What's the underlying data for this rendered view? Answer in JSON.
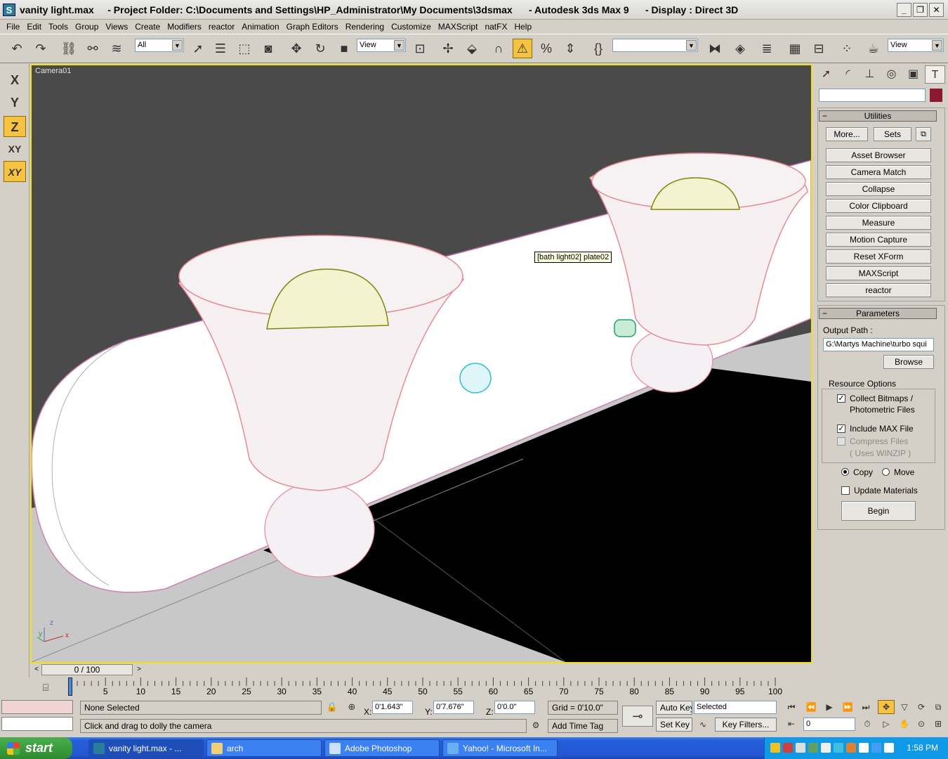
{
  "window": {
    "app_icon": "3ds-max-icon",
    "title": "vanity light.max     - Project Folder: C:\\Documents and Settings\\HP_Administrator\\My Documents\\3dsmax      - Autodesk 3ds Max 9      - Display : Direct 3D",
    "min_label": "_",
    "max_label": "❐",
    "close_label": "✕"
  },
  "menu": [
    "File",
    "Edit",
    "Tools",
    "Group",
    "Views",
    "Create",
    "Modifiers",
    "reactor",
    "Animation",
    "Graph Editors",
    "Rendering",
    "Customize",
    "MAXScript",
    "natFX",
    "Help"
  ],
  "toolbar": {
    "selection_filter": "All",
    "ref_coord": "View",
    "named_selection": "",
    "render_view": "View"
  },
  "axes": [
    "X",
    "Y",
    "Z",
    "XY",
    "XY"
  ],
  "viewport": {
    "label": "Camera01",
    "tooltip": "[bath light02] plate02",
    "axis_tripod": {
      "x": "x",
      "y": "y",
      "z": "z"
    }
  },
  "command_panel": {
    "utilities": {
      "header": "Utilities",
      "more": "More...",
      "sets": "Sets",
      "buttons": [
        "Asset Browser",
        "Camera Match",
        "Collapse",
        "Color Clipboard",
        "Measure",
        "Motion Capture",
        "Reset XForm",
        "MAXScript",
        "reactor"
      ]
    },
    "parameters": {
      "header": "Parameters",
      "output_path_label": "Output Path :",
      "output_path_value": "G:\\Martys Machine\\turbo squi",
      "browse": "Browse",
      "resource_options": "Resource Options",
      "collect_bitmaps_1": "Collect Bitmaps /",
      "collect_bitmaps_2": "Photometric Files",
      "collect_checked": true,
      "include_max": "Include MAX File",
      "include_checked": true,
      "compress": "Compress Files",
      "uses_winzip": "( Uses WINZIP )",
      "copy": "Copy",
      "move": "Move",
      "update_materials": "Update Materials",
      "begin": "Begin"
    }
  },
  "time_slider": {
    "position": "0 / 100",
    "frame": 0,
    "total": 100,
    "ticks": [
      0,
      5,
      10,
      15,
      20,
      25,
      30,
      35,
      40,
      45,
      50,
      55,
      60,
      65,
      70,
      75,
      80,
      85,
      90,
      95,
      100
    ]
  },
  "status": {
    "selection": "None Selected",
    "prompt": "Click and drag to dolly the camera",
    "x_label": "X:",
    "x_value": "0'1.643\"",
    "y_label": "Y:",
    "y_value": "0'7.676\"",
    "z_label": "Z:",
    "z_value": "0'0.0\"",
    "grid": "Grid = 0'10.0\"",
    "add_time_tag": "Add Time Tag",
    "auto_key": "Auto Key",
    "set_key": "Set Key",
    "selected": "Selected",
    "key_filters": "Key Filters...",
    "current_frame": "0"
  },
  "taskbar": {
    "start": "start",
    "tasks": [
      "vanity light.max     - ...",
      "arch",
      "Adobe Photoshop",
      "Yahoo! - Microsoft In..."
    ],
    "clock": "1:58 PM"
  },
  "colors": {
    "viewport_border": "#f0e020",
    "active_tool": "#f5c242",
    "wire_pink": "#e88a98",
    "wire_green": "#7a8a10",
    "wire_cyan": "#30c0d0"
  }
}
